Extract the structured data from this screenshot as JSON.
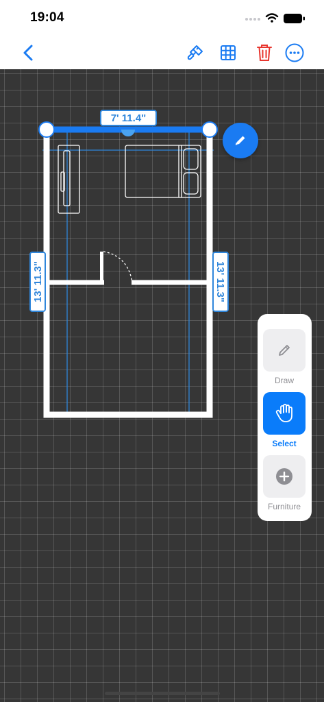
{
  "status_bar": {
    "time": "19:04"
  },
  "nav": {
    "back_icon": "chevron-left-icon",
    "actions": [
      "paintbrush-icon",
      "grid-icon",
      "trash-icon",
      "more-icon"
    ],
    "accent_color": "#1a7bf2",
    "delete_color": "#e8362f"
  },
  "floorplan": {
    "dimension_width": "7' 11.4\"",
    "dimension_left": "13' 11.3\"",
    "dimension_right": "13' 11.3\""
  },
  "tools": {
    "items": [
      {
        "label": "Draw",
        "icon": "pencil-icon",
        "selected": false
      },
      {
        "label": "Select",
        "icon": "hand-icon",
        "selected": true
      },
      {
        "label": "Furniture",
        "icon": "plus-circle-icon",
        "selected": false
      }
    ]
  }
}
